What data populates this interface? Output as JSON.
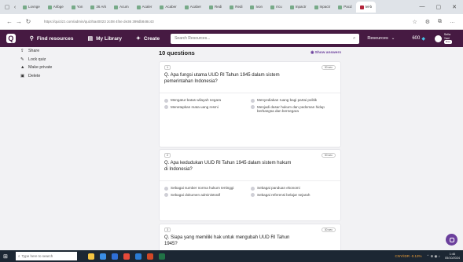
{
  "browser": {
    "tabs": [
      {
        "label": "Lovnge"
      },
      {
        "label": "Aribge"
      },
      {
        "label": "Yon"
      },
      {
        "label": "36 Ark"
      },
      {
        "label": "Acum"
      },
      {
        "label": "Acaler"
      },
      {
        "label": "Acaber"
      },
      {
        "label": "Acaber"
      },
      {
        "label": "Redi"
      },
      {
        "label": "Redi"
      },
      {
        "label": "Ivon"
      },
      {
        "label": "rrcu"
      },
      {
        "label": "Inpactr"
      },
      {
        "label": "Inpactr"
      },
      {
        "label": "Pacd"
      },
      {
        "label": "Ivi-b"
      }
    ],
    "url": "https://quizizz.com/admin/quiz/5a40023 2c08 4f4e de36 399db848c43"
  },
  "app": {
    "nav": {
      "find_resources": "Find resources",
      "my_library": "My Library",
      "create": "Create"
    },
    "search_placeholder": "Search Resources...",
    "resources_label": "Resources",
    "coins": "600",
    "user_name": "Sella Yani",
    "user_badge": "Free",
    "logo_letter": "Q"
  },
  "left_menu": [
    {
      "label": "Share",
      "icon": "share-icon",
      "glyph": "⇪"
    },
    {
      "label": "Lock quiz",
      "icon": "lock-icon",
      "glyph": "✎"
    },
    {
      "label": "Make private",
      "icon": "private-icon",
      "glyph": "▲"
    },
    {
      "label": "Delete",
      "icon": "trash-icon",
      "glyph": "▣"
    }
  ],
  "questions_header": {
    "count_label": "10 questions",
    "show_answers": "Show answers"
  },
  "questions": [
    {
      "number": "1",
      "time": "30 sec",
      "text": "Q. Apa fungsi utama UUD RI Tahun 1945 dalam sistem pemerintahan Indonesia?",
      "options": [
        "Mengatur batas wilayah negara",
        "Menyediakan ruang bagi partai politik",
        "Menetapkan mata uang resmi",
        "Menjadi dasar hukum dan pedoman hidup berbangsa dan bernegara"
      ]
    },
    {
      "number": "2",
      "time": "30 sec",
      "text": "Q. Apa kedudukan UUD RI Tahun 1945 dalam sistem hukum di Indonesia?",
      "options": [
        "Sebagai sumber norma hukum tertinggi",
        "Sebagai panduan ekonomi",
        "Sebagai dokumen administratif",
        "Sebagai referensi belajar sejarah"
      ]
    },
    {
      "number": "3",
      "time": "30 sec",
      "text": "Q. Siapa yang memiliki hak untuk mengubah UUD RI Tahun 1945?",
      "options": []
    }
  ],
  "taskbar": {
    "search_placeholder": "Type here to search",
    "stock": "CNY/IDR",
    "stock_change": "-0.13%",
    "time": "1:46",
    "date": "05/10/2024"
  }
}
